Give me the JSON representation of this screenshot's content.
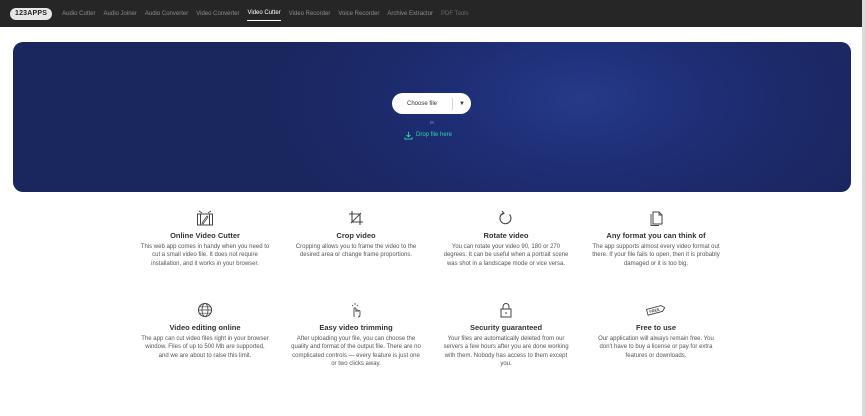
{
  "nav": {
    "logo": "123APPS",
    "items": [
      {
        "label": "Audio Cutter",
        "active": false
      },
      {
        "label": "Audio Joiner",
        "active": false
      },
      {
        "label": "Audio Converter",
        "active": false
      },
      {
        "label": "Video Converter",
        "active": false
      },
      {
        "label": "Video Cutter",
        "active": true
      },
      {
        "label": "Video Recorder",
        "active": false
      },
      {
        "label": "Voice Recorder",
        "active": false
      },
      {
        "label": "Archive Extractor",
        "active": false
      },
      {
        "label": "PDF Tools",
        "active": false
      }
    ]
  },
  "hero": {
    "choose_file": "Choose file",
    "or": "or",
    "drop_file": "Drop file here",
    "accent_color": "#2bd6a8",
    "background_color": "#1c2a6a"
  },
  "features": [
    {
      "icon": "film-edit-icon",
      "title": "Online Video Cutter",
      "desc": "This web app comes in handy when you need to cut a small video file. It does not require installation, and it works in your browser."
    },
    {
      "icon": "crop-icon",
      "title": "Crop video",
      "desc": "Cropping allows you to frame the video to the desired area or change frame proportions."
    },
    {
      "icon": "rotate-icon",
      "title": "Rotate video",
      "desc": "You can rotate your video 90, 180 or 270 degrees. It can be useful when a portrait scene was shot in a landscape mode or vice versa."
    },
    {
      "icon": "files-icon",
      "title": "Any format you can think of",
      "desc": "The app supports almost every video format out there. If your file fails to open, then it is probably damaged or it is too big."
    },
    {
      "icon": "globe-icon",
      "title": "Video editing online",
      "desc": "The app can cut video files right in your browser window. Files of up to 500 Mb are supported, and we are about to raise this limit."
    },
    {
      "icon": "hand-click-icon",
      "title": "Easy video trimming",
      "desc": "After uploading your file, you can choose the quality and format of the output file. There are no complicated controls — every feature is just one or two clicks away."
    },
    {
      "icon": "lock-icon",
      "title": "Security guaranteed",
      "desc": "Your files are automatically deleted from our servers a few hours after you are done working with them. Nobody has access to them except you."
    },
    {
      "icon": "free-tag-icon",
      "icon_text": "FREE",
      "title": "Free to use",
      "desc": "Our application will always remain free. You don't have to buy a license or pay for extra features or downloads."
    }
  ]
}
